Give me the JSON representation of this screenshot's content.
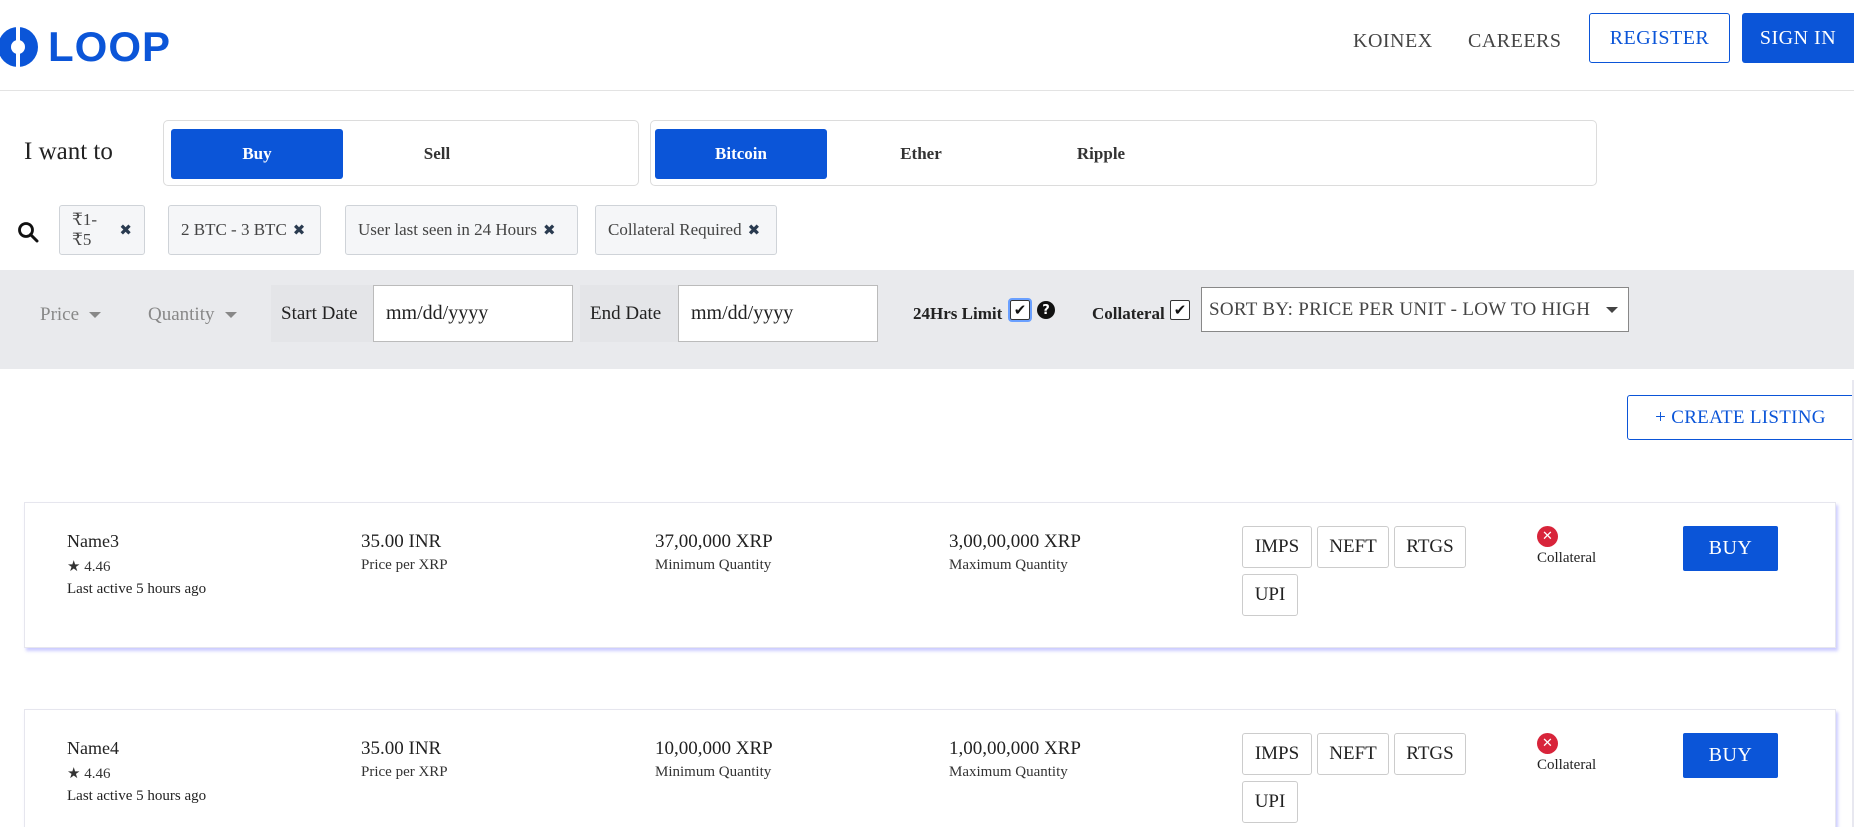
{
  "header": {
    "logo_text": "LOOP",
    "nav": [
      "KOINEX",
      "CAREERS"
    ],
    "register_label": "REGISTER",
    "signin_label": "SIGN IN"
  },
  "trade": {
    "prompt": "I want to",
    "actions": [
      {
        "label": "Buy",
        "active": true
      },
      {
        "label": "Sell",
        "active": false
      }
    ],
    "coins": [
      {
        "label": "Bitcoin",
        "active": true
      },
      {
        "label": "Ether",
        "active": false
      },
      {
        "label": "Ripple",
        "active": false
      }
    ]
  },
  "chips": [
    {
      "label": "₹1-₹5"
    },
    {
      "label": "2 BTC - 3 BTC"
    },
    {
      "label": "User last seen in 24 Hours"
    },
    {
      "label": "Collateral Required"
    }
  ],
  "filters": {
    "price_label": "Price",
    "quantity_label": "Quantity",
    "start_date_label": "Start Date",
    "start_date_value": "mm/dd/yyyy",
    "end_date_label": "End Date",
    "end_date_value": "mm/dd/yyyy",
    "limit_label": "24Hrs Limit",
    "limit_checked": true,
    "collateral_label": "Collateral",
    "collateral_checked": true,
    "sort_label": "SORT BY: PRICE PER UNIT - LOW TO HIGH"
  },
  "create_label": "+ CREATE LISTING",
  "listings": [
    {
      "name": "Name3",
      "rating": "★ 4.46",
      "last_active": "Last active 5 hours ago",
      "price": "35.00 INR",
      "price_sub": "Price per XRP",
      "min": "37,00,000 XRP",
      "min_sub": "Minimum Quantity",
      "max": "3,00,00,000 XRP",
      "max_sub": "Maximum Quantity",
      "payments": [
        "IMPS",
        "NEFT",
        "RTGS",
        "UPI"
      ],
      "collateral": "Collateral",
      "buy_label": "BUY"
    },
    {
      "name": "Name4",
      "rating": "★ 4.46",
      "last_active": "Last active 5 hours ago",
      "price": "35.00 INR",
      "price_sub": "Price per XRP",
      "min": "10,00,000 XRP",
      "min_sub": "Minimum Quantity",
      "max": "1,00,00,000 XRP",
      "max_sub": "Maximum Quantity",
      "payments": [
        "IMPS",
        "NEFT",
        "RTGS",
        "UPI"
      ],
      "collateral": "Collateral",
      "buy_label": "BUY"
    }
  ],
  "colors": {
    "brand": "#0b55d8",
    "danger": "#d8243a"
  }
}
